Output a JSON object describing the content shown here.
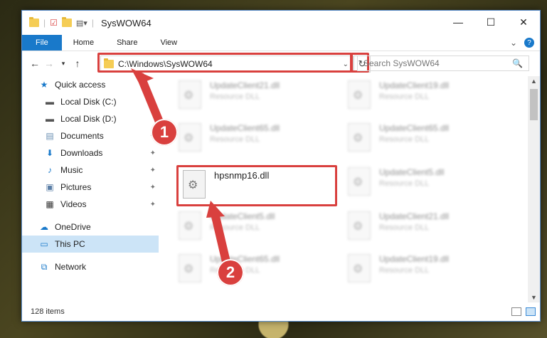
{
  "window": {
    "title": "SysWOW64",
    "controls": {
      "minimize": "—",
      "maximize": "☐",
      "close": "✕"
    }
  },
  "ribbon": {
    "tabs": [
      "File",
      "Home",
      "Share",
      "View"
    ],
    "expand": "⌄",
    "help": "?"
  },
  "address": {
    "path": "C:\\Windows\\SysWOW64",
    "dropdown": "⌄",
    "refresh": "↻"
  },
  "search": {
    "placeholder": "Search SysWOW64",
    "icon": "🔍"
  },
  "sidebar": {
    "items": [
      {
        "label": "Quick access",
        "icon": "star-icon",
        "glyph": "★",
        "pinned": false
      },
      {
        "label": "Local Disk (C:)",
        "icon": "drive-icon",
        "glyph": "▬",
        "pinned": false
      },
      {
        "label": "Local Disk (D:)",
        "icon": "drive-icon",
        "glyph": "▬",
        "pinned": false
      },
      {
        "label": "Documents",
        "icon": "documents-icon",
        "glyph": "▤",
        "pinned": true
      },
      {
        "label": "Downloads",
        "icon": "download-icon",
        "glyph": "⬇",
        "pinned": true
      },
      {
        "label": "Music",
        "icon": "music-icon",
        "glyph": "♪",
        "pinned": true
      },
      {
        "label": "Pictures",
        "icon": "pictures-icon",
        "glyph": "▣",
        "pinned": true
      },
      {
        "label": "Videos",
        "icon": "video-icon",
        "glyph": "▦",
        "pinned": true
      },
      {
        "label": "OneDrive",
        "icon": "cloud-icon",
        "glyph": "☁",
        "pinned": false
      },
      {
        "label": "This PC",
        "icon": "computer-icon",
        "glyph": "▭",
        "pinned": false
      },
      {
        "label": "Network",
        "icon": "network-icon",
        "glyph": "⧉",
        "pinned": false
      }
    ],
    "pin_glyph": "📌"
  },
  "files": {
    "highlighted": {
      "name": "hpsnmp16.dll"
    },
    "background": [
      {
        "name": "UpdateClient21.dll",
        "type": "Resource DLL"
      },
      {
        "name": "UpdateClient19.dll",
        "type": "Resource DLL"
      },
      {
        "name": "UpdateClient65.dll",
        "type": "Resource DLL"
      },
      {
        "name": "UpdateClient65.dll",
        "type": "Resource DLL"
      },
      {
        "name": "UpdateClient5.dll",
        "type": "Resource DLL"
      },
      {
        "name": "UpdateClient5.dll",
        "type": "Resource DLL"
      },
      {
        "name": "UpdateClient21.dll",
        "type": "Resource DLL"
      },
      {
        "name": "UpdateClient65.dll",
        "type": "Resource DLL"
      },
      {
        "name": "UpdateClient19.dll",
        "type": "Resource DLL"
      }
    ]
  },
  "status": {
    "count": "128 items"
  },
  "annotations": {
    "step1": "1",
    "step2": "2",
    "color": "#d9403e"
  }
}
